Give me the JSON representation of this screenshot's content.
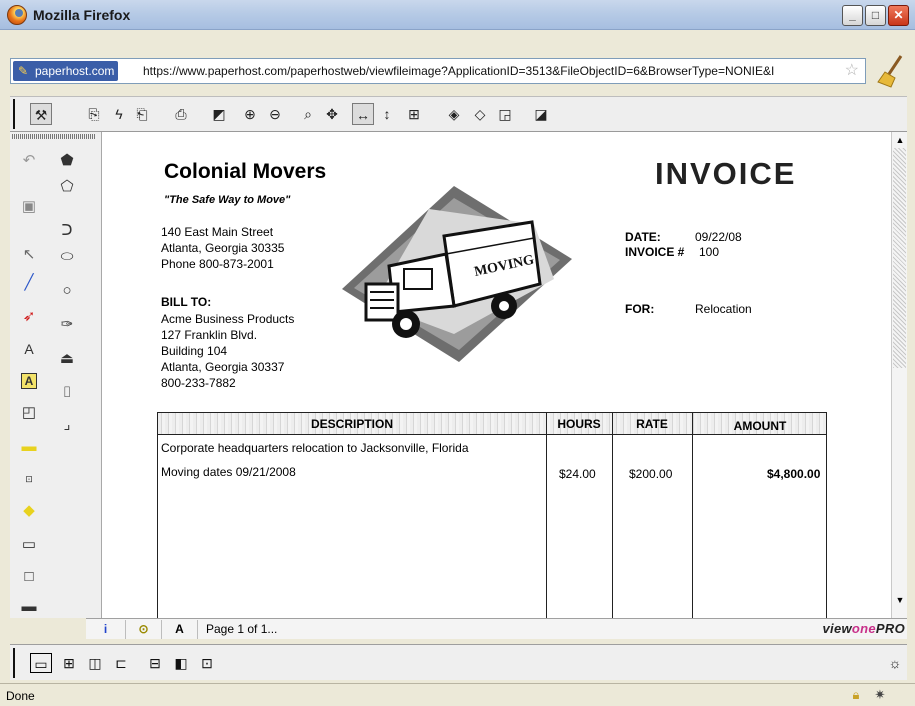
{
  "window": {
    "title": "Mozilla Firefox"
  },
  "urlbar": {
    "site_badge": "paperhost.com",
    "url": "https://www.paperhost.com/paperhostweb/viewfileimage?ApplicationID=3513&FileObjectID=6&BrowserType=NONIE&I"
  },
  "invoice": {
    "company": "Colonial Movers",
    "tagline": "\"The Safe Way to Move\"",
    "address": [
      "140 East Main Street",
      "Atlanta, Georgia 30335",
      "Phone 800-873-2001"
    ],
    "bill_to_label": "BILL TO:",
    "bill_to": [
      "Acme Business Products",
      "127 Franklin Blvd.",
      "Building 104",
      "Atlanta, Georgia 30337",
      "800-233-7882"
    ],
    "title": "INVOICE",
    "date_label": "DATE:",
    "date": "09/22/08",
    "number_label": "INVOICE #",
    "number": "100",
    "for_label": "FOR:",
    "for": "Relocation",
    "truck_text": "MOVING",
    "table": {
      "headers": [
        "DESCRIPTION",
        "HOURS",
        "RATE",
        "AMOUNT"
      ],
      "rows": [
        {
          "description": "Corporate headquarters relocation to Jacksonville, Florida",
          "hours": "",
          "rate": "",
          "amount": ""
        },
        {
          "description": "Moving dates 09/21/2008",
          "hours": "$24.00",
          "rate": "$200.00",
          "amount": "$4,800.00"
        }
      ]
    }
  },
  "viewer_status": {
    "tabs": [
      "i",
      "⊙",
      "A"
    ],
    "page_text": "Page 1 of 1...",
    "brand": [
      "view",
      "one",
      "PRO"
    ]
  },
  "browser_status": {
    "text": "Done"
  },
  "icons": {
    "viewer_toolbar": [
      "select-tool-icon",
      "page-prev-icon",
      "lightning-icon",
      "page-next-icon",
      "print-icon",
      "highlight-arrow-icon",
      "zoom-in-icon",
      "zoom-out-icon",
      "zoom-rect-icon",
      "pan-icon",
      "fit-width-icon",
      "fit-height-icon",
      "fit-page-icon",
      "rotate-left-icon",
      "rotate-right-icon",
      "page-flip-icon",
      "invert-icon"
    ],
    "palette": [
      "undo-icon",
      "pentagon-filled-icon",
      "polygon-icon",
      "save-icon",
      "polyline-icon",
      "pointer-icon",
      "ellipse-icon",
      "line-icon",
      "circle-icon",
      "arrow-icon",
      "pen-icon",
      "text-icon",
      "stamp-icon",
      "text-box-icon",
      "ruler-icon",
      "note-icon",
      "angle-icon",
      "highlight-rect-icon",
      "hyperlink-icon",
      "diamond-icon",
      "rectangle-icon",
      "small-rectangle-icon",
      "filled-rectangle-icon"
    ],
    "layout_toolbar": [
      "single-page-icon",
      "thumbnails-icon",
      "two-page-icon",
      "split-icon",
      "vertical-split-icon",
      "horizontal-split-icon",
      "four-pane-icon",
      "brightness-icon"
    ]
  }
}
